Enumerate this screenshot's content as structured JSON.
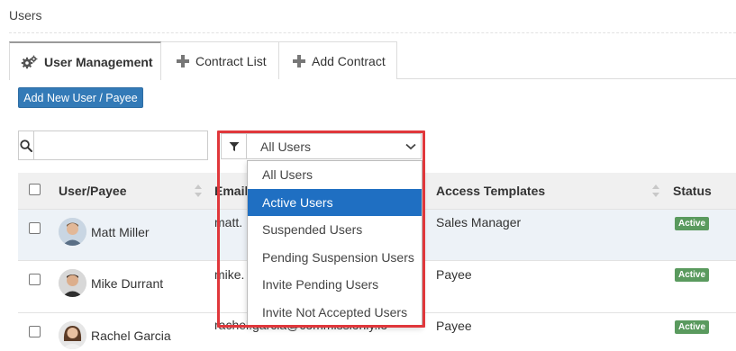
{
  "page": {
    "title": "Users"
  },
  "tabs": [
    {
      "label": "User Management",
      "icon": "gears-icon",
      "active": true
    },
    {
      "label": "Contract List",
      "icon": "plus-icon",
      "active": false
    },
    {
      "label": "Add Contract",
      "icon": "plus-icon",
      "active": false
    }
  ],
  "toolbar": {
    "add_user_label": "Add New User / Payee"
  },
  "search": {
    "placeholder": "",
    "value": ""
  },
  "filter": {
    "selected": "All Users",
    "options": [
      "All Users",
      "Active Users",
      "Suspended Users",
      "Pending Suspension Users",
      "Invite Pending Users",
      "Invite Not Accepted Users"
    ],
    "highlighted_option": "Active Users"
  },
  "table": {
    "columns": [
      "User/Payee",
      "Email",
      "Access Templates",
      "Status"
    ],
    "rows": [
      {
        "name": "Matt Miller",
        "email": "matt.",
        "access": "Sales Manager",
        "status": "Active"
      },
      {
        "name": "Mike Durrant",
        "email": "mike.",
        "access": "Payee",
        "status": "Active"
      },
      {
        "name": "Rachel Garcia",
        "email": "rachel.garcia@commissionly.io",
        "access": "Payee",
        "status": "Active"
      }
    ]
  },
  "colors": {
    "primary": "#337ab7",
    "dropdown_selected": "#1f6fc2",
    "highlight_border": "#e0373b",
    "status_active": "#5a9a5e"
  }
}
